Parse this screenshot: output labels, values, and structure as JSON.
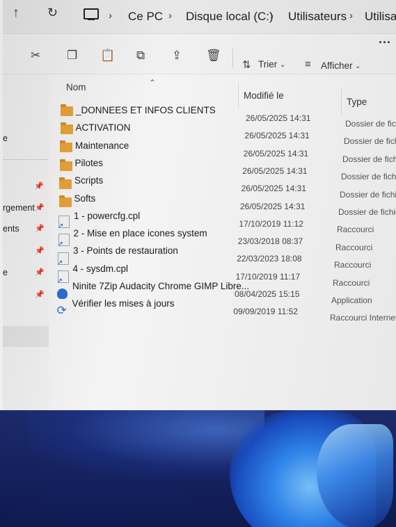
{
  "addressbar": {
    "up_icon": "up-arrow-icon",
    "refresh_icon": "refresh-icon",
    "crumbs": [
      "Ce PC",
      "Disque local (C:)",
      "Utilisateurs",
      "Utilisate"
    ]
  },
  "toolbar": {
    "icons": [
      "scissors-icon",
      "copy-icon",
      "paste-icon",
      "rename-icon",
      "share-icon",
      "trash-icon"
    ],
    "sort_label": "Trier",
    "view_label": "Afficher",
    "more": "..."
  },
  "sidebar": {
    "items": [
      "e",
      "rgement",
      "ents",
      "e"
    ]
  },
  "columns": {
    "name": "Nom",
    "modified": "Modifié le",
    "type": "Type"
  },
  "files": [
    {
      "name": "_DONNEES ET INFOS CLIENTS",
      "modified": "26/05/2025 14:31",
      "type": "Dossier de fichi",
      "icon": "folder-icon"
    },
    {
      "name": "ACTIVATION",
      "modified": "26/05/2025 14:31",
      "type": "Dossier de fichi",
      "icon": "folder-icon"
    },
    {
      "name": "Maintenance",
      "modified": "26/05/2025 14:31",
      "type": "Dossier de fichie",
      "icon": "folder-icon"
    },
    {
      "name": "Pilotes",
      "modified": "26/05/2025 14:31",
      "type": "Dossier de fichier",
      "icon": "folder-icon"
    },
    {
      "name": "Scripts",
      "modified": "26/05/2025 14:31",
      "type": "Dossier de fichier",
      "icon": "folder-icon"
    },
    {
      "name": "Softs",
      "modified": "26/05/2025 14:31",
      "type": "Dossier de fichiers",
      "icon": "folder-icon"
    },
    {
      "name": "1 - powercfg.cpl",
      "modified": "17/10/2019 11:12",
      "type": "Raccourci",
      "icon": "shortcut-icon"
    },
    {
      "name": "2 - Mise en place icones system",
      "modified": "23/03/2018 08:37",
      "type": "Raccourci",
      "icon": "shortcut-icon"
    },
    {
      "name": "3 - Points de restauration",
      "modified": "22/03/2023 18:08",
      "type": "Raccourci",
      "icon": "shortcut-icon"
    },
    {
      "name": "4 - sysdm.cpl",
      "modified": "17/10/2019 11:17",
      "type": "Raccourci",
      "icon": "shortcut-icon"
    },
    {
      "name": "Ninite 7Zip Audacity Chrome GIMP Libre...",
      "modified": "08/04/2025 15:15",
      "type": "Application",
      "icon": "application-icon"
    },
    {
      "name": "Vérifier les mises à jours",
      "modified": "09/09/2019 11:52",
      "type": "Raccourci Internet",
      "icon": "internet-shortcut-icon"
    }
  ]
}
